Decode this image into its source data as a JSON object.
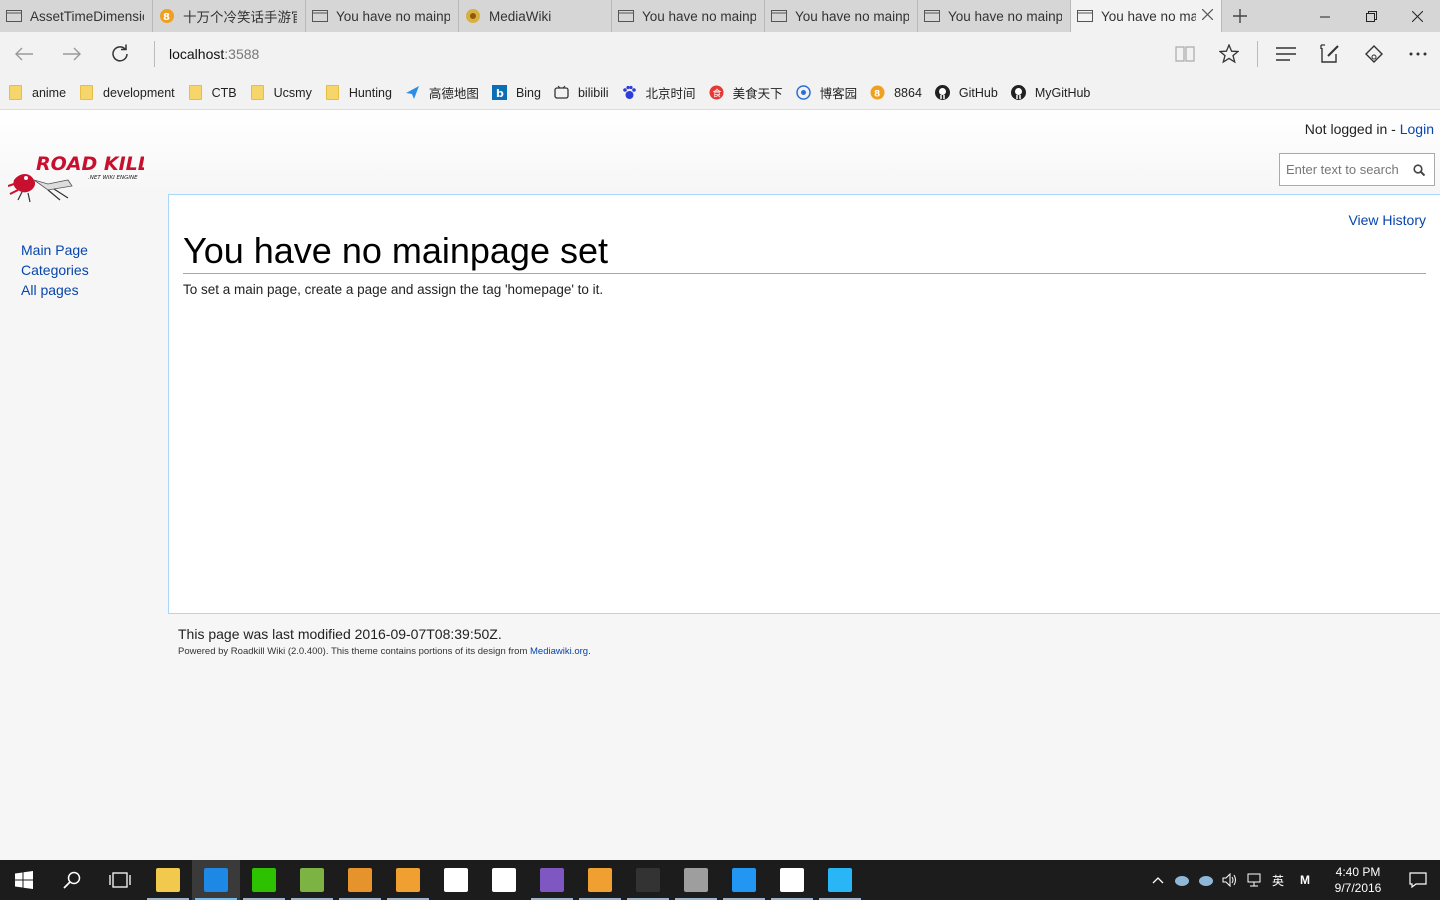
{
  "tabs": [
    {
      "label": "AssetTimeDimensic",
      "icon": "page-icon"
    },
    {
      "label": "十万个冷笑话手游​官",
      "icon": "8864-icon"
    },
    {
      "label": "You have no mainp",
      "icon": "page-icon"
    },
    {
      "label": "MediaWiki",
      "icon": "mediawiki-icon"
    },
    {
      "label": "You have no mainp",
      "icon": "page-icon"
    },
    {
      "label": "You have no mainp",
      "icon": "page-icon"
    },
    {
      "label": "You have no mainp",
      "icon": "page-icon"
    },
    {
      "label": "You have no ma",
      "icon": "page-icon"
    }
  ],
  "address": {
    "host": "localhost",
    "port": ":3588"
  },
  "favorites": [
    {
      "label": "anime",
      "icon": "folder-icon"
    },
    {
      "label": "development",
      "icon": "folder-icon"
    },
    {
      "label": "CTB",
      "icon": "folder-icon"
    },
    {
      "label": "Ucsmy",
      "icon": "folder-icon"
    },
    {
      "label": "Hunting",
      "icon": "folder-icon"
    },
    {
      "label": "高德地图",
      "icon": "amap-icon"
    },
    {
      "label": "Bing",
      "icon": "bing-icon"
    },
    {
      "label": "bilibili",
      "icon": "bilibili-icon"
    },
    {
      "label": "北京时间",
      "icon": "baidu-icon"
    },
    {
      "label": "美食天下",
      "icon": "meishi-icon"
    },
    {
      "label": "博客园",
      "icon": "cnblogs-icon"
    },
    {
      "label": "8864",
      "icon": "8864-icon"
    },
    {
      "label": "GitHub",
      "icon": "github-icon"
    },
    {
      "label": "MyGitHub",
      "icon": "github-icon"
    }
  ],
  "header": {
    "not_logged_in": "Not logged in - ",
    "login_link": "Login",
    "search_placeholder": "Enter text to search"
  },
  "sidebar": {
    "items": [
      {
        "label": "Main Page"
      },
      {
        "label": "Categories"
      },
      {
        "label": "All pages"
      }
    ]
  },
  "content": {
    "view_history": "View History",
    "title": "You have no mainpage set",
    "body": "To set a main page, create a page and assign the tag 'homepage' to it."
  },
  "footer": {
    "modified": "This page was last modified 2016-09-07T08:39:50Z.",
    "powered_prefix": "Powered by Roadkill Wiki (2.0.400). This theme contains portions of its design from ",
    "powered_link": "Mediawiki.org",
    "powered_suffix": "."
  },
  "logo": {
    "title": "ROAD KILL",
    "subtitle": ".NET WIKI ENGINE"
  },
  "taskbar": {
    "apps": [
      {
        "name": "file-explorer",
        "color": "#f2c94c",
        "running": true,
        "active": false
      },
      {
        "name": "edge",
        "color": "#1e88e5",
        "running": true,
        "active": true
      },
      {
        "name": "wechat",
        "color": "#2dc100",
        "running": true,
        "active": false
      },
      {
        "name": "notepad",
        "color": "#7cb342",
        "running": true,
        "active": false
      },
      {
        "name": "app-orange",
        "color": "#e6932c",
        "running": true,
        "active": false
      },
      {
        "name": "search-tool",
        "color": "#f0a030",
        "running": true,
        "active": false
      },
      {
        "name": "store",
        "color": "#ffffff",
        "running": false,
        "active": false
      },
      {
        "name": "mail",
        "color": "#ffffff",
        "running": false,
        "active": false
      },
      {
        "name": "visual-studio",
        "color": "#7e57c2",
        "running": true,
        "active": false
      },
      {
        "name": "sublime",
        "color": "#f0a030",
        "running": true,
        "active": false
      },
      {
        "name": "terminal",
        "color": "#333333",
        "running": true,
        "active": false
      },
      {
        "name": "remote-desktop",
        "color": "#9e9e9e",
        "running": true,
        "active": false
      },
      {
        "name": "editor",
        "color": "#2196f3",
        "running": true,
        "active": false
      },
      {
        "name": "calculator",
        "color": "#ffffff",
        "running": true,
        "active": false
      },
      {
        "name": "network-app",
        "color": "#29b6f6",
        "running": true,
        "active": false
      }
    ],
    "ime": "英",
    "ime2": "M",
    "time": "4:40 PM",
    "date": "9/7/2016"
  }
}
